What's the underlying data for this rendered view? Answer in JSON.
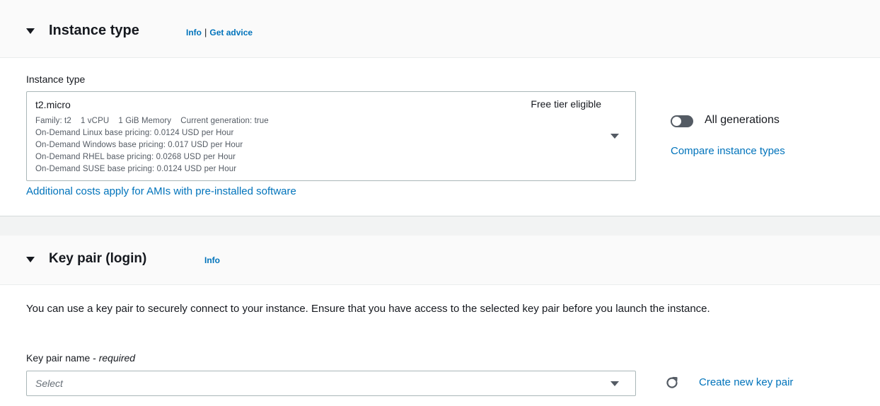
{
  "instance_section": {
    "title": "Instance type",
    "info_link": "Info",
    "separator": "|",
    "advice_link": "Get advice",
    "field_label": "Instance type",
    "selected": {
      "name": "t2.micro",
      "badge": "Free tier eligible",
      "family_line": "Family: t2    1 vCPU    1 GiB Memory    Current generation: true",
      "pricing_lines": [
        "On-Demand Linux base pricing: 0.0124 USD per Hour",
        "On-Demand Windows base pricing: 0.017 USD per Hour",
        "On-Demand RHEL base pricing: 0.0268 USD per Hour",
        "On-Demand SUSE base pricing: 0.0124 USD per Hour"
      ]
    },
    "toggle": {
      "label": "All generations",
      "on": false
    },
    "compare_link": "Compare instance types",
    "additional_costs_link": "Additional costs apply for AMIs with pre-installed software"
  },
  "keypair_section": {
    "title": "Key pair (login)",
    "info_link": "Info",
    "description": "You can use a key pair to securely connect to your instance. Ensure that you have access to the selected key pair before you launch the instance.",
    "field_label": "Key pair name - ",
    "field_label_required": "required",
    "select_placeholder": "Select",
    "create_link": "Create new key pair"
  },
  "colors": {
    "link": "#0073bb",
    "text": "#16191f",
    "muted": "#545b64",
    "header_bg": "#fafafa",
    "toggle_off": "#545b64"
  },
  "icons": {
    "section_caret": "caret-down-icon",
    "select_caret": "chevron-down-icon",
    "refresh": "refresh-icon"
  }
}
